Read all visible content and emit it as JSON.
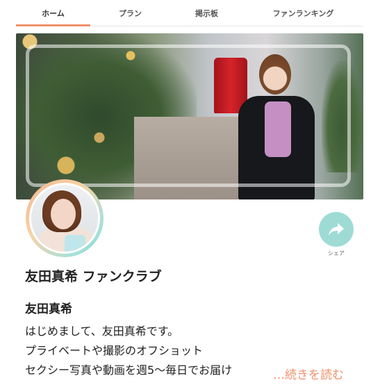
{
  "tabs": [
    {
      "label": "ホーム",
      "active": true
    },
    {
      "label": "プラン",
      "active": false
    },
    {
      "label": "掲示板",
      "active": false
    },
    {
      "label": "ファンランキング",
      "active": false
    }
  ],
  "profile": {
    "club_name": "友田真希 ファンクラブ",
    "owner_name": "友田真希",
    "description_lines": [
      "はじめまして、友田真希です。",
      "プライベートや撮影のオフショット",
      "セクシー写真や動画を週5〜毎日でお届け"
    ],
    "read_more": "…続きを読む"
  },
  "share": {
    "label": "シェア",
    "icon": "share-arrow-icon"
  },
  "colors": {
    "accent": "#f0916c",
    "share_bg": "#9edbd5"
  }
}
